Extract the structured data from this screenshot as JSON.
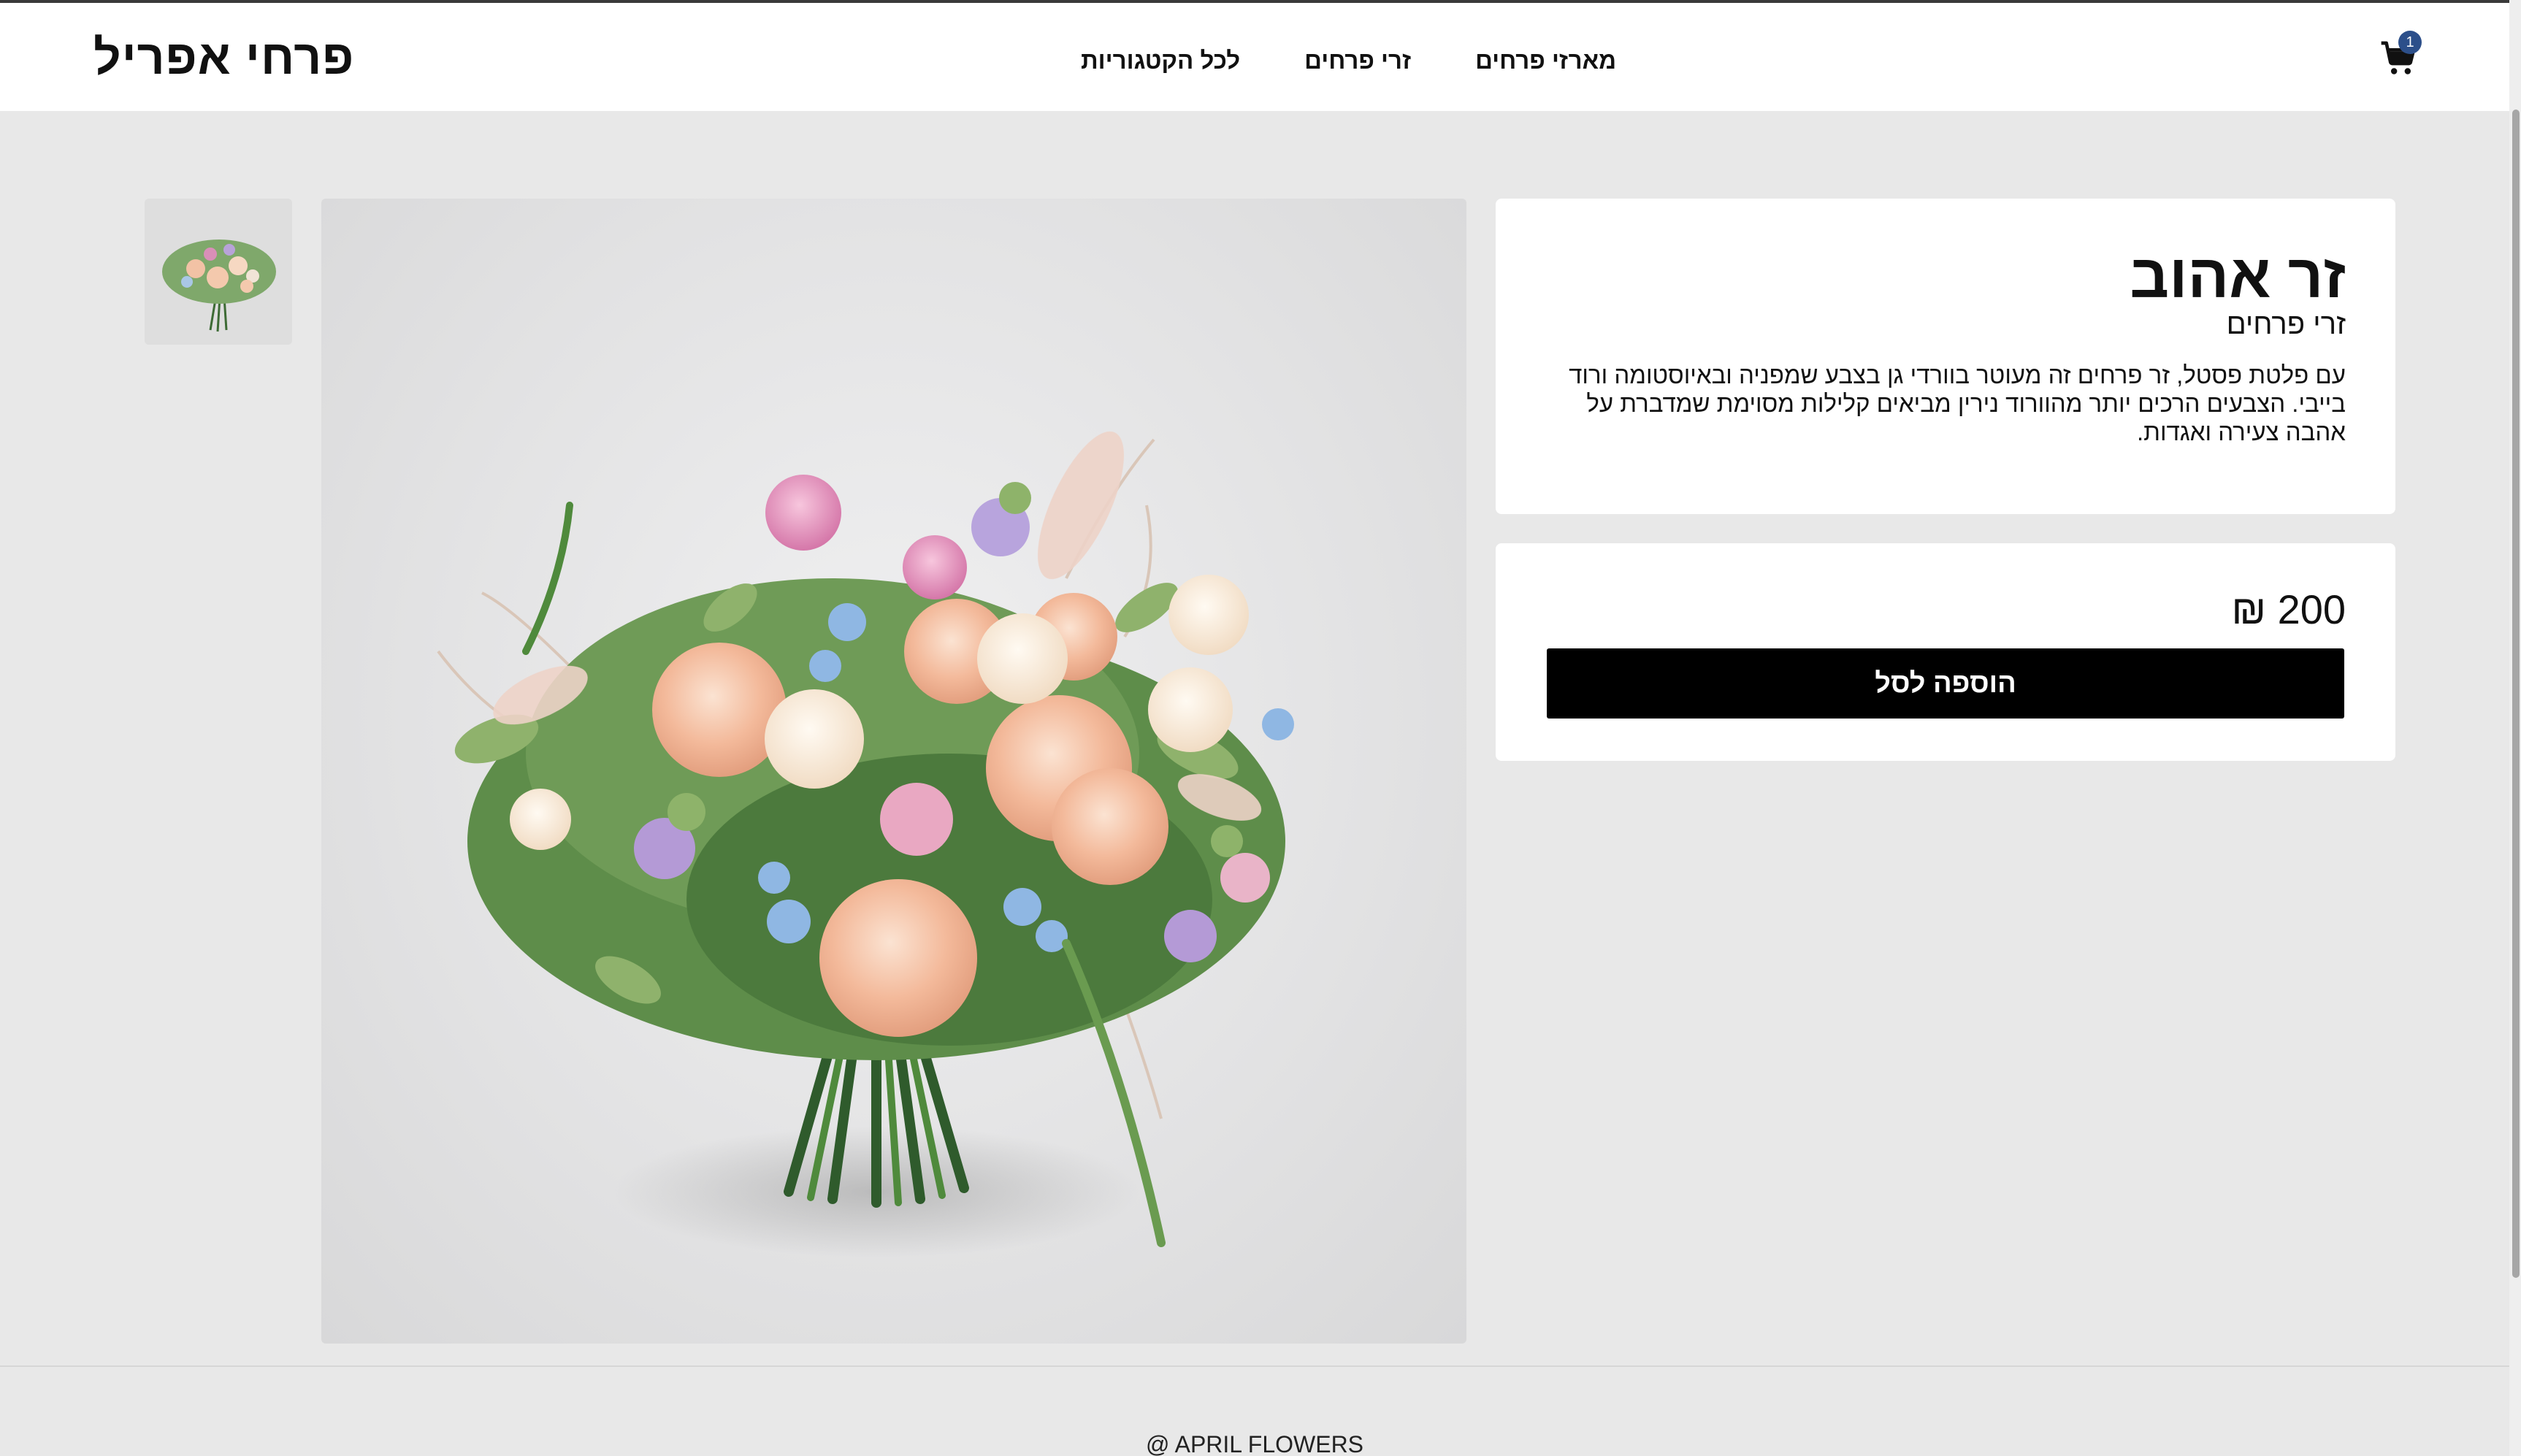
{
  "header": {
    "logo": "פרחי אפריל",
    "nav": [
      {
        "label": "לכל הקטגוריות"
      },
      {
        "label": "זרי פרחים"
      },
      {
        "label": "מארזי פרחים"
      }
    ],
    "cart_count": "1",
    "cart_icon": "shopping-cart-icon"
  },
  "gallery": {
    "thumbnail_icon": "flower-bouquet-thumbnail",
    "main_image_icon": "flower-bouquet-photo"
  },
  "product": {
    "title": "זר אהוב",
    "category": "זרי פרחים",
    "description": "עם פלטת פסטל, זר פרחים זה מעוטר בוורדי גן בצבע שמפניה ובאיוסטומה ורוד בייבי. הצבעים הרכים יותר מהוורוד נירין מביאים קלילות מסוימת שמדברת על אהבה צעירה ואגדות.",
    "price": "200 ₪",
    "add_to_cart_label": "הוספה לסל"
  },
  "footer": {
    "copyright": "@ APRIL FLOWERS"
  },
  "colors": {
    "background": "#e8e8e8",
    "card": "#ffffff",
    "button": "#000000",
    "badge": "#2c4f8a"
  }
}
